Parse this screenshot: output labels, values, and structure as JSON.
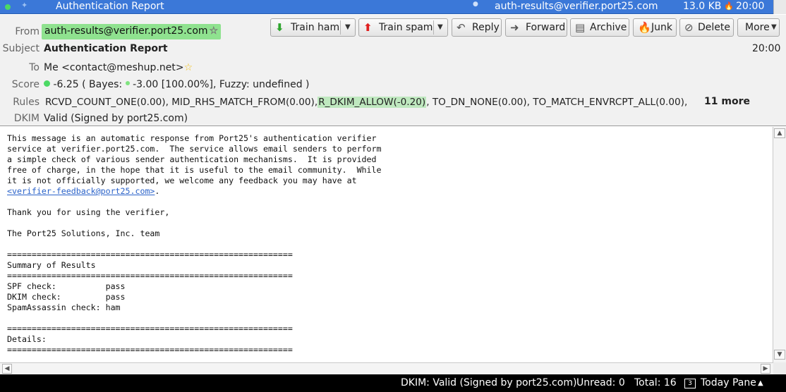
{
  "message_row": {
    "subject": "Authentication Report",
    "from": "auth-results@verifier.port25.com",
    "size": "13.0 KB",
    "time": "20:00"
  },
  "header": {
    "from_label": "From",
    "from_value": "auth-results@verifier.port25.com",
    "subject_label": "Subject",
    "subject_value": "Authentication Report",
    "date": "20:00",
    "to_label": "To",
    "to_value": "Me <contact@meshup.net>",
    "score_label": "Score",
    "score_value": "-6.25",
    "bayes_prefix": "( Bayes:",
    "bayes_value": "-3.00 [100.00%], Fuzzy: undefined )",
    "rules_label": "Rules",
    "rules_before": "RCVD_COUNT_ONE(0.00), MID_RHS_MATCH_FROM(0.00),",
    "rules_highlight": "R_DKIM_ALLOW(-0.20)",
    "rules_after": ", TO_DN_NONE(0.00), TO_MATCH_ENVRCPT_ALL(0.00),",
    "rules_more": "11 more",
    "dkim_label": "DKIM",
    "dkim_value": "Valid (Signed by port25.com)"
  },
  "toolbar": {
    "train_ham": "Train ham",
    "train_spam": "Train spam",
    "reply": "Reply",
    "forward": "Forward",
    "archive": "Archive",
    "junk": "Junk",
    "delete": "Delete",
    "more": "More"
  },
  "body": {
    "para1": "This message is an automatic response from Port25's authentication verifier\nservice at verifier.port25.com.  The service allows email senders to perform\na simple check of various sender authentication mechanisms.  It is provided\nfree of charge, in the hope that it is useful to the email community.  While\nit is not officially supported, we welcome any feedback you may have at\n",
    "link": "<verifier-feedback@port25.com>",
    "after_link": ".\n\nThank you for using the verifier,\n\nThe Port25 Solutions, Inc. team\n\n==========================================================\nSummary of Results\n==========================================================\nSPF check:          pass\nDKIM check:         pass\nSpamAssassin check: ham\n\n==========================================================\nDetails:\n=========================================================="
  },
  "status": {
    "dkim": "DKIM: Valid (Signed by port25.com)",
    "unread": "Unread: 0",
    "total": "Total: 16",
    "calendar_day": "3",
    "today_pane": "Today Pane"
  },
  "colors": {
    "selection": "#3b78d8",
    "from_highlight": "#8fe28f",
    "rule_highlight": "#bfe8bf",
    "ham_arrow": "#2ea52e",
    "spam_arrow": "#e02020",
    "link": "#2a62c9"
  },
  "icons": [
    "green-dot-icon",
    "star-icon",
    "down-arrow-icon",
    "up-arrow-icon",
    "reply-icon",
    "forward-icon",
    "archive-icon",
    "junk-icon",
    "delete-icon",
    "chevron-down-icon",
    "calendar-icon"
  ]
}
